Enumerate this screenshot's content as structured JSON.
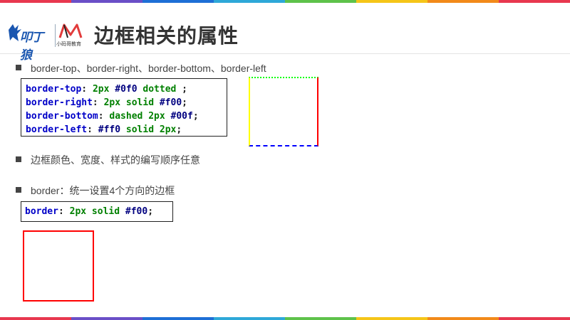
{
  "header": {
    "title": "边框相关的属性",
    "logo_text": "叩丁狼",
    "logo2_sub": "小码哥教育"
  },
  "bullets": [
    "border-top、border-right、border-bottom、border-left",
    "边框颜色、宽度、样式的编写顺序任意",
    "border：统一设置4个方向的边框"
  ],
  "code1": [
    {
      "prop": "border-top",
      "colon": ": ",
      "a": "2",
      "b": "px",
      "c": " #0f0",
      "d": " dotted",
      "e": " ;"
    },
    {
      "prop": "border-right",
      "colon": ": ",
      "a": "2",
      "b": "px",
      "c": " solid",
      "d": " #f00",
      "e": ";"
    },
    {
      "prop": "border-bottom",
      "colon": ": ",
      "a": "dashed",
      "b": " 2",
      "c": "px",
      "d": " #00f",
      "e": ";"
    },
    {
      "prop": "border-left",
      "colon": ": ",
      "a": "#ff0",
      "b": " solid",
      "c": " 2",
      "d": "px",
      "e": ";"
    }
  ],
  "code2": {
    "prop": "border",
    "colon": ": ",
    "a": "2",
    "b": "px",
    "c": " solid",
    "d": " #f00",
    "e": ";"
  },
  "colors": {
    "rainbow": [
      "#e8374f",
      "#6a4fc7",
      "#1e6fd6",
      "#2ea8d8",
      "#5ec24a",
      "#f5c518",
      "#f28a1a",
      "#e8374f"
    ],
    "border_top": "#0f0",
    "border_right": "#f00",
    "border_bottom": "#00f",
    "border_left": "#ff0"
  }
}
